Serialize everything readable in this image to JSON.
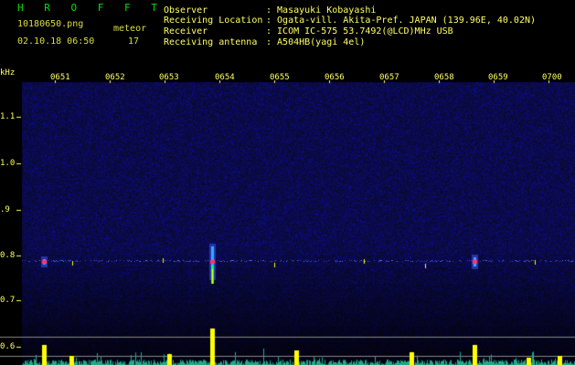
{
  "header": {
    "logo": "H R O F F T",
    "filename": "10180650.png",
    "datetime": "02.10.18 06:50",
    "meteor_label": "meteor",
    "meteor_count": "17",
    "observer_label": "Observer",
    "observer_value": ": Masayuki Kobayashi",
    "location_label": "Receiving Location",
    "location_value": ": Ogata-vill. Akita-Pref. JAPAN (139.96E, 40.02N)",
    "receiver_label": "Receiver",
    "receiver_value": ": ICOM IC-575 53.7492(@LCD)MHz USB",
    "antenna_label": "Receiving antenna",
    "antenna_value": ": A504HB(yagi 4el)"
  },
  "axes": {
    "y_unit": "kHz",
    "y_ticks": [
      "1.1",
      "1.0",
      ".9",
      "0.8",
      "0.7",
      "0.6"
    ],
    "x_ticks": [
      "0651",
      "0652",
      "0653",
      "0654",
      "0655",
      "0656",
      "0657",
      "0658",
      "0659",
      "0700"
    ]
  },
  "colors": {
    "background": "#000000",
    "text": "#ffff66",
    "logo": "#00e000",
    "noise": "#1a1a7a",
    "echo_line": "#ffff00",
    "echo_core": "#ff3366"
  }
}
